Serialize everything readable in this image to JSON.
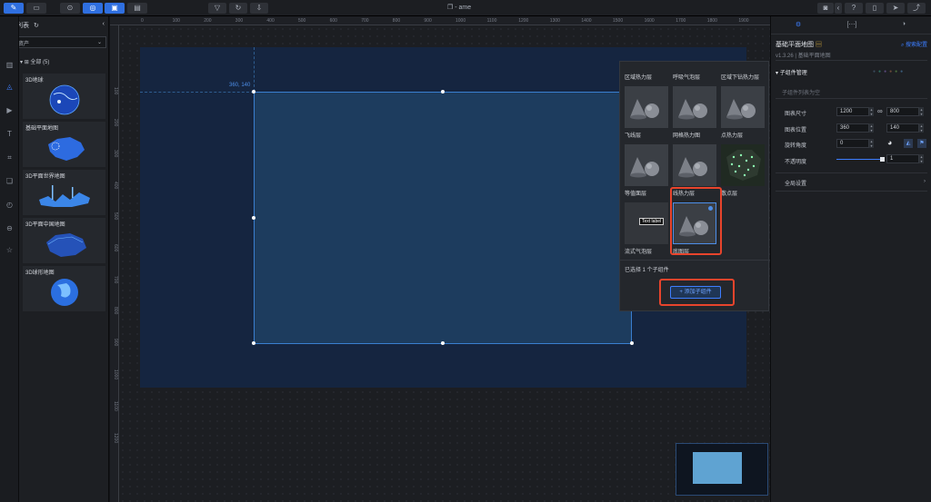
{
  "window": {
    "title": "- ame"
  },
  "toolbar": {
    "left_buttons": [
      "edit-icon",
      "layers-icon",
      "layout-icon",
      "target-icon",
      "panel-icon",
      "box-icon"
    ],
    "center_buttons": [
      "filter-icon",
      "refresh-icon",
      "download-icon"
    ],
    "right_buttons": [
      "camera-icon",
      "collapse-icon",
      "help-icon",
      "book-icon",
      "send-icon",
      "share-icon"
    ]
  },
  "left_panel": {
    "title": "组件列表",
    "filter_value": "全部资产",
    "tree_head": "全部 (5)",
    "assets": [
      {
        "label": "3D地球"
      },
      {
        "label": "基础平面地图"
      },
      {
        "label": "3D平面世界地图"
      },
      {
        "label": "3D平面中国地图"
      },
      {
        "label": "3D球形地图"
      }
    ]
  },
  "ruler": {
    "top_ticks": [
      "0",
      "100",
      "200",
      "300",
      "400",
      "500",
      "600",
      "700",
      "800",
      "900",
      "1000",
      "1100",
      "1200",
      "1300",
      "1400",
      "1500",
      "1600",
      "1700",
      "1800",
      "1900"
    ],
    "left_ticks": [
      "100",
      "200",
      "300",
      "400",
      "500",
      "600",
      "700",
      "800",
      "900",
      "1000",
      "1100",
      "1200"
    ]
  },
  "canvas": {
    "coord_label": "360, 140"
  },
  "popup": {
    "top_labels": [
      "区域热力层",
      "呼吸气泡层",
      "区域下钻热力层"
    ],
    "layers": [
      {
        "name": "飞线层",
        "preview": "cone"
      },
      {
        "name": "网格热力图",
        "preview": "cone"
      },
      {
        "name": "点热力层",
        "preview": "cone"
      },
      {
        "name": "等值面层",
        "preview": "cone"
      },
      {
        "name": "线热力层",
        "preview": "cone"
      },
      {
        "name": "散点层",
        "preview": "map"
      },
      {
        "name": "流式气泡层",
        "preview": "label"
      },
      {
        "name": "底图层",
        "preview": "cone"
      }
    ],
    "text_label_tag": "Text label",
    "selected_count": "已选择 1 个子组件",
    "add_button": "+ 添加子组件"
  },
  "right_panel": {
    "tabs": [
      "settings-icon",
      "data-icon",
      "interaction-icon"
    ],
    "component_title": "基础平面地图",
    "version": "v1.3.26 | 基础平面地图",
    "search_link": "搜索配置",
    "section_title": "子组件管理",
    "empty_list": "子组件列表为空",
    "size_label": "图表尺寸",
    "size_w": "1200",
    "size_h": "800",
    "pos_label": "图表位置",
    "pos_x": "360",
    "pos_y": "140",
    "rotate_label": "旋转角度",
    "rotate_value": "0",
    "opacity_label": "不透明度",
    "opacity_value": "1",
    "global_label": "全局设置"
  },
  "colors": {
    "accent": "#3d7eff",
    "highlight": "#e8442c",
    "screen": "#152540"
  }
}
